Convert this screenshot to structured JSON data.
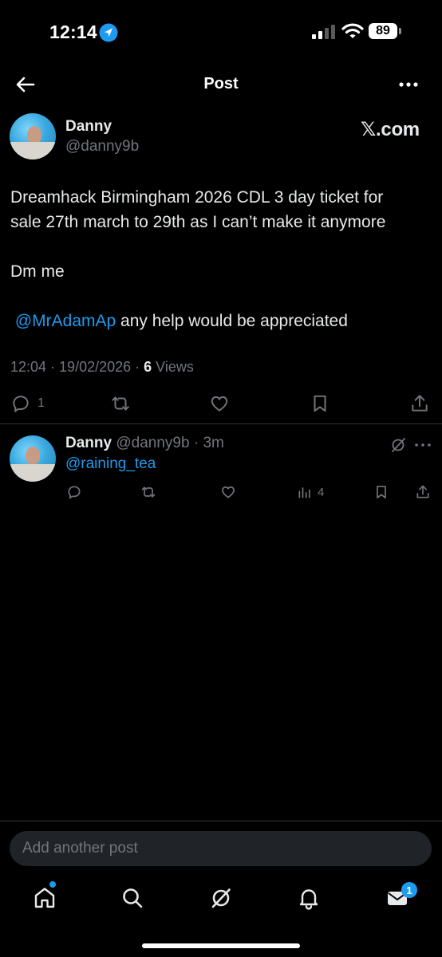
{
  "status_bar": {
    "time": "12:14",
    "battery": "89"
  },
  "header": {
    "title": "Post"
  },
  "post": {
    "author_name": "Danny",
    "author_handle": "@danny9b",
    "source_label": "𝕏.com",
    "text_line1": "Dreamhack Birmingham 2026 CDL 3 day ticket for",
    "text_line2": "sale 27th march to 29th as I can’t make it anymore",
    "text_line3": "Dm me",
    "mention": "@MrAdamAp",
    "text_line4_rest": " any help would be appreciated",
    "time": "12:04",
    "sep1": " · ",
    "date": "19/02/2026",
    "sep2": " · ",
    "views_count": "6",
    "views_label": " Views",
    "reply_count": "1"
  },
  "reply": {
    "author_name": "Danny",
    "author_handle": "@danny9b",
    "sep": " · ",
    "age": "3m",
    "mention": "@raining_tea",
    "views_count": "4"
  },
  "compose": {
    "placeholder": "Add another post"
  },
  "tabbar": {
    "messages_badge": "1"
  },
  "colors": {
    "accent": "#1d9bf0",
    "background": "#000000",
    "muted": "#71767b"
  },
  "icons": [
    "location-arrow-icon",
    "signal-icon",
    "wifi-icon",
    "back-arrow-icon",
    "more-icon",
    "reply-icon",
    "repost-icon",
    "like-icon",
    "bookmark-icon",
    "share-icon",
    "grok-icon",
    "views-icon",
    "home-icon",
    "search-icon",
    "bell-icon",
    "mail-icon"
  ]
}
